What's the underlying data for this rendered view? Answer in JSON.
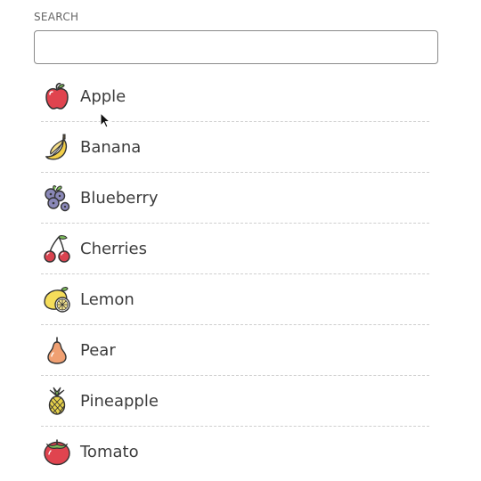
{
  "search": {
    "label": "SEARCH",
    "value": "",
    "placeholder": ""
  },
  "fruits": [
    {
      "label": "Apple",
      "icon": "apple-icon"
    },
    {
      "label": "Banana",
      "icon": "banana-icon"
    },
    {
      "label": "Blueberry",
      "icon": "blueberry-icon"
    },
    {
      "label": "Cherries",
      "icon": "cherries-icon"
    },
    {
      "label": "Lemon",
      "icon": "lemon-icon"
    },
    {
      "label": "Pear",
      "icon": "pear-icon"
    },
    {
      "label": "Pineapple",
      "icon": "pineapple-icon"
    },
    {
      "label": "Tomato",
      "icon": "tomato-icon"
    }
  ],
  "colors": {
    "apple": "#e0444f",
    "banana": "#f2cf4a",
    "blueberry": "#8a88b8",
    "cherries": "#d9434f",
    "lemon": "#f5dd5a",
    "pear": "#f0a072",
    "pineapple": "#e8d24a",
    "tomato": "#e0444f",
    "leaf": "#7dbf5a",
    "outline": "#333333"
  }
}
